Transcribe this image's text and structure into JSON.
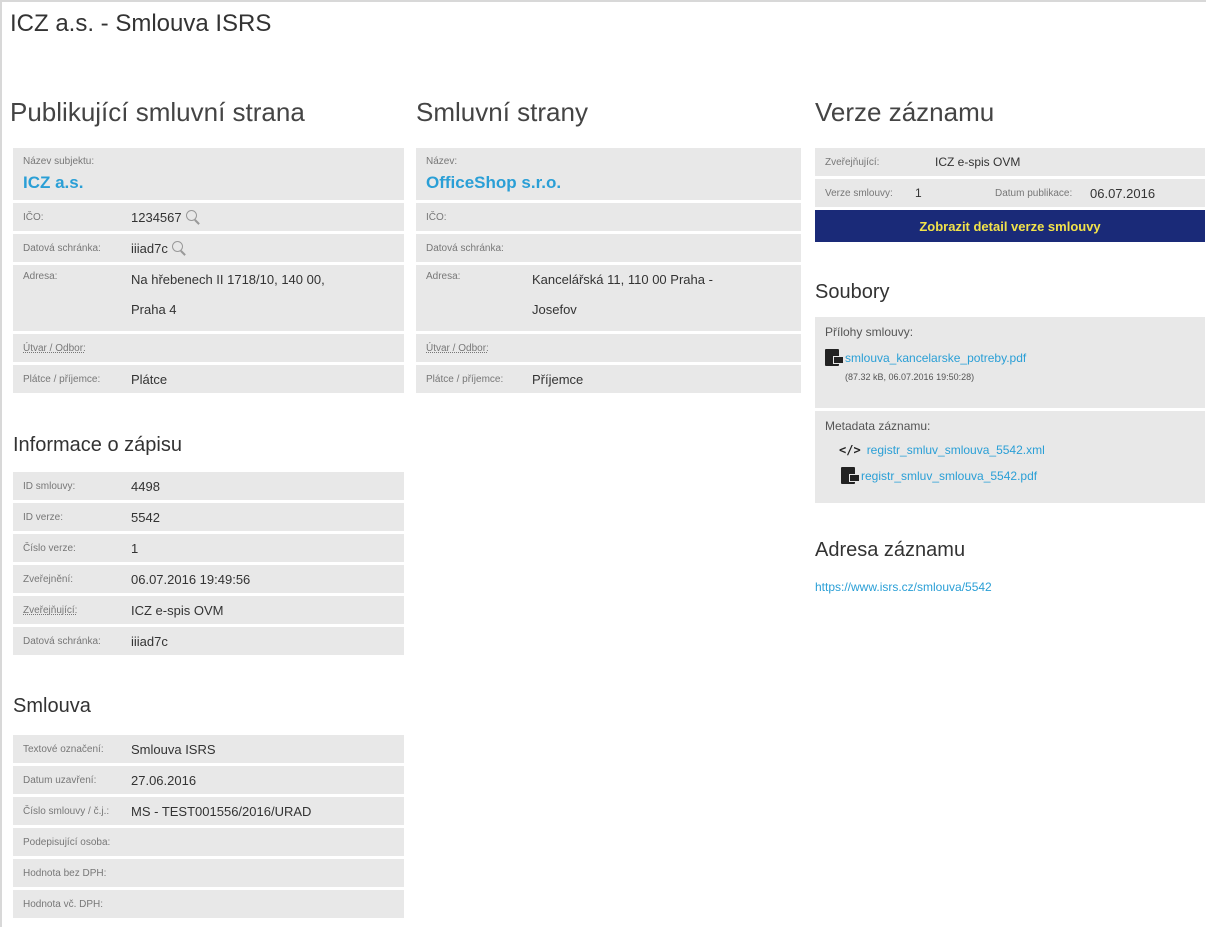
{
  "page_title": "ICZ a.s. - Smlouva ISRS",
  "publisher": {
    "heading": "Publikující smluvní strana",
    "name_label": "Název subjektu:",
    "name_value": "ICZ a.s.",
    "rows": [
      {
        "label": "IČO:",
        "value": "1234567",
        "search": true
      },
      {
        "label": "Datová schránka:",
        "value": "iiiad7c",
        "search": true
      },
      {
        "label": "Adresa:",
        "value": "Na hřebenech II 1718/10, 140 00,",
        "value2": "Praha 4"
      },
      {
        "label": "Útvar / Odbor:",
        "value": ""
      },
      {
        "label": "Plátce / příjemce:",
        "value": "Plátce"
      }
    ]
  },
  "record_info": {
    "heading": "Informace o zápisu",
    "rows": [
      {
        "label": "ID smlouvy:",
        "value": "4498"
      },
      {
        "label": "ID verze:",
        "value": "5542"
      },
      {
        "label": "Číslo verze:",
        "value": "1"
      },
      {
        "label": "Zveřejnění:",
        "value": "06.07.2016 19:49:56"
      },
      {
        "label": "Zveřejňující:",
        "value": "ICZ e-spis OVM"
      },
      {
        "label": "Datová schránka:",
        "value": "iiiad7c"
      }
    ]
  },
  "contract": {
    "heading": "Smlouva",
    "rows": [
      {
        "label": "Textové označení:",
        "value": "Smlouva ISRS"
      },
      {
        "label": "Datum uzavření:",
        "value": "27.06.2016"
      },
      {
        "label": "Číslo smlouvy / č.j.:",
        "value": "MS - TEST001556/2016/URAD"
      },
      {
        "label": "Podepisující osoba:",
        "value": ""
      },
      {
        "label": "Hodnota bez DPH:",
        "value": ""
      },
      {
        "label": "Hodnota vč. DPH:",
        "value": ""
      }
    ]
  },
  "parties": {
    "heading": "Smluvní strany",
    "name_label": "Název:",
    "name_value": "OfficeShop s.r.o.",
    "rows": [
      {
        "label": "IČO:",
        "value": ""
      },
      {
        "label": "Datová schránka:",
        "value": ""
      },
      {
        "label": "Adresa:",
        "value": "Kancelářská 11, 110 00 Praha -",
        "value2": "Josefov"
      },
      {
        "label": "Útvar / Odbor:",
        "value": ""
      },
      {
        "label": "Plátce / příjemce:",
        "value": "Příjemce"
      }
    ]
  },
  "version": {
    "heading": "Verze záznamu",
    "publisher_label": "Zveřejňující:",
    "publisher_value": "ICZ e-spis OVM",
    "version_label": "Verze smlouvy:",
    "version_value": "1",
    "date_label": "Datum publikace:",
    "date_value": "06.07.2016",
    "detail_button": "Zobrazit detail verze smlouvy"
  },
  "files": {
    "heading": "Soubory",
    "attachments_label": "Přílohy smlouvy:",
    "attachment_name": "smlouva_kancelarske_potreby.pdf",
    "attachment_meta": "(87.32 kB, 06.07.2016 19:50:28)",
    "metadata_label": "Metadata záznamu:",
    "metadata_xml": "registr_smluv_smlouva_5542.xml",
    "metadata_pdf": "registr_smluv_smlouva_5542.pdf"
  },
  "record_address": {
    "heading": "Adresa záznamu",
    "url": "https://www.isrs.cz/smlouva/5542"
  },
  "colors": {
    "accent": "#2a9fd6",
    "button_bg": "#1a2a78",
    "button_text": "#f2e34a",
    "row_bg": "#e8e8e8"
  }
}
